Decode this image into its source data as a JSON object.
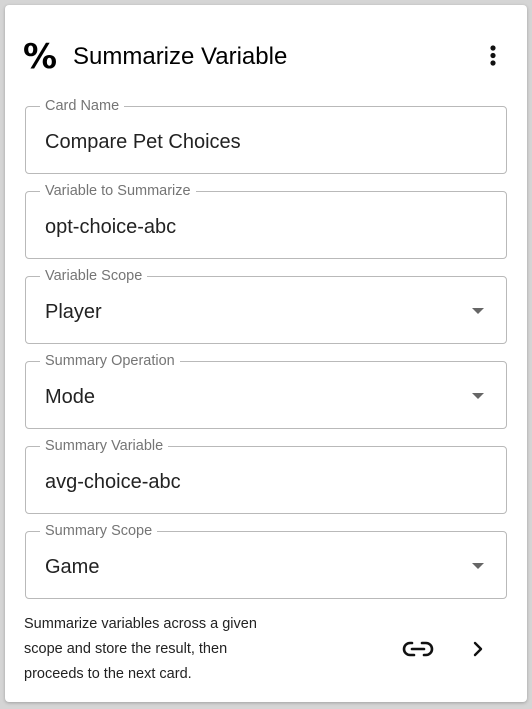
{
  "header": {
    "icon": "percent-icon",
    "icon_glyph": "%",
    "title": "Summarize Variable",
    "menu_icon": "kebab-menu-icon"
  },
  "fields": {
    "card_name": {
      "label": "Card Name",
      "value": "Compare Pet Choices"
    },
    "variable_to_summarize": {
      "label": "Variable to Summarize",
      "value": "opt-choice-abc"
    },
    "variable_scope": {
      "label": "Variable Scope",
      "value": "Player"
    },
    "summary_operation": {
      "label": "Summary Operation",
      "value": "Mode"
    },
    "summary_variable": {
      "label": "Summary Variable",
      "value": "avg-choice-abc"
    },
    "summary_scope": {
      "label": "Summary Scope",
      "value": "Game"
    }
  },
  "footer": {
    "description_line1": "Summarize variables across a given",
    "description_line2": "scope and store the result, then",
    "description_line3": "proceeds to the next card.",
    "link_icon": "link-icon",
    "next_icon": "chevron-right-icon"
  }
}
